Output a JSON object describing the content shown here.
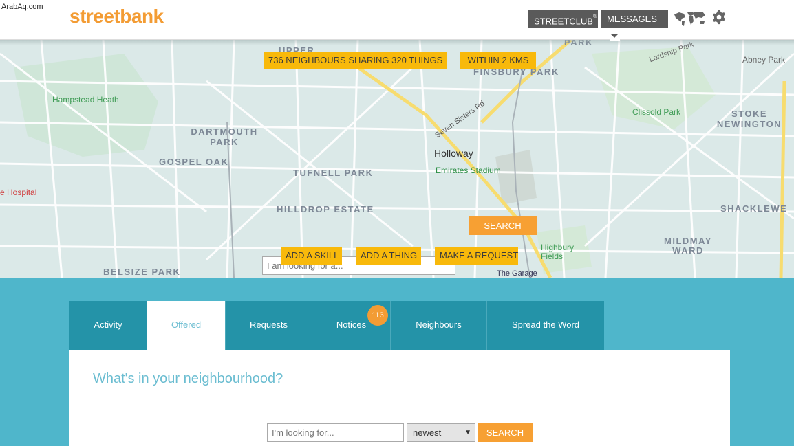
{
  "watermark": "ArabAq.com",
  "header": {
    "logo": "streetbank",
    "streetclub_label": "STREETCLUB",
    "streetclub_reg": "®",
    "messages_label": "MESSAGES"
  },
  "map": {
    "neighbours_summary": "736 NEIGHBOURS SHARING 320 THINGS",
    "radius": "WITHIN 2 KMS",
    "search_placeholder": "I am looking for a...",
    "search_button": "SEARCH",
    "add_skill": "ADD A SKILL",
    "add_thing": "ADD A THING",
    "make_request": "MAKE A REQUEST",
    "labels": {
      "finsbury_park": "FINSBURY PARK",
      "abney_park": "Abney Park",
      "hampstead_heath": "Hampstead Heath",
      "dartmouth_park": "DARTMOUTH PARK",
      "gospel_oak": "GOSPEL OAK",
      "tufnell_park": "TUFNELL PARK",
      "holloway": "Holloway",
      "emirates_stadium": "Emirates Stadium",
      "clissold_park": "Clissold Park",
      "stoke_newington": "STOKE NEWINGTON",
      "hilldrop_estate": "HILLDROP ESTATE",
      "shacklewell": "SHACKLEWE",
      "mildmay_ward": "MILDMAY WARD",
      "highbury_fields": "Highbury Fields",
      "belsize_park": "BELSIZE PARK",
      "the_garage": "The Garage",
      "hospital": "e Hospital",
      "seven_sisters_rd": "Seven Sisters Rd",
      "lordship_park": "Lordship Park",
      "upper": "UPPER",
      "park_top": "PARK"
    }
  },
  "tabs": [
    {
      "label": "Activity"
    },
    {
      "label": "Offered"
    },
    {
      "label": "Requests"
    },
    {
      "label": "Notices"
    },
    {
      "label": "Neighbours"
    },
    {
      "label": "Spread the Word"
    }
  ],
  "notices_badge": "113",
  "panel": {
    "title": "What's in your neighbourhood?",
    "search_placeholder": "I'm looking for...",
    "sort_value": "newest",
    "search_button": "SEARCH"
  },
  "colors": {
    "brand_orange": "#f39c34",
    "yellow": "#f8b90b",
    "teal": "#4fb6cb",
    "tab_teal": "#2493a8"
  }
}
